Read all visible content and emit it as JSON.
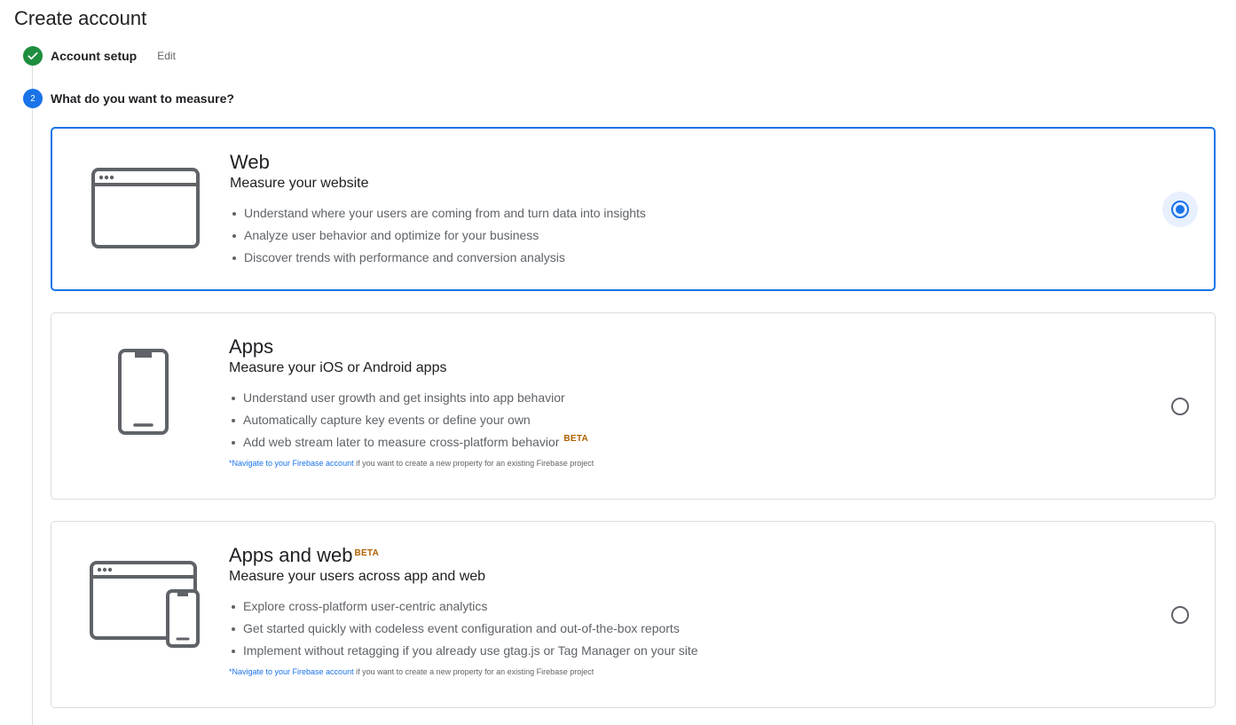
{
  "page": {
    "title": "Create account"
  },
  "steps": [
    {
      "label": "Account setup",
      "edit_label": "Edit",
      "status": "complete"
    },
    {
      "number": "2",
      "label": "What do you want to measure?",
      "status": "active"
    }
  ],
  "options": [
    {
      "id": "web",
      "title": "Web",
      "subtitle": "Measure your website",
      "bullets": [
        "Understand where your users are coming from and turn data into insights",
        "Analyze user behavior and optimize for your business",
        "Discover trends with performance and conversion analysis"
      ],
      "selected": true,
      "icon": "browser-window-icon"
    },
    {
      "id": "apps",
      "title": "Apps",
      "subtitle": "Measure your iOS or Android apps",
      "bullets": [
        "Understand user growth and get insights into app behavior",
        "Automatically capture key events or define your own",
        "Add web stream later to measure cross-platform behavior"
      ],
      "bullet_badge": "BETA",
      "note_link": "*Navigate to your Firebase account",
      "note_text": " if you want to create a new property for an existing Firebase project",
      "selected": false,
      "icon": "smartphone-icon"
    },
    {
      "id": "apps-and-web",
      "title": "Apps and web",
      "title_badge": "BETA",
      "subtitle": "Measure your users across app and web",
      "bullets": [
        "Explore cross-platform user-centric analytics",
        "Get started quickly with codeless event configuration and out-of-the-box reports",
        "Implement without retagging if you already use gtag.js or Tag Manager on your site"
      ],
      "note_link": "*Navigate to your Firebase account",
      "note_text": " if you want to create a new property for an existing Firebase project",
      "selected": false,
      "icon": "browser-and-phone-icon"
    }
  ],
  "colors": {
    "accent": "#1a73e8",
    "success": "#1e8e3e",
    "beta": "#b06000",
    "border": "#dadce0"
  }
}
